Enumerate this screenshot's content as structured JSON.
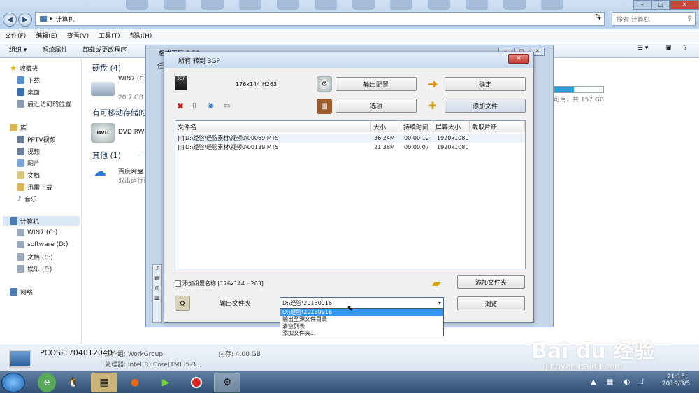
{
  "explorer": {
    "address": "计算机",
    "search_placeholder": "搜索 计算机",
    "menu": [
      "文件(F)",
      "编辑(E)",
      "查看(V)",
      "工具(T)",
      "帮助(H)"
    ],
    "toolbar": [
      "组织 ▾",
      "系统属性",
      "卸载或更改程序"
    ],
    "sidebar": {
      "favorites": "收藏夹",
      "fav_items": [
        "下载",
        "桌面",
        "最近访问的位置"
      ],
      "libraries": "库",
      "lib_items": [
        "PPTV视频",
        "视频",
        "图片",
        "文档",
        "迅雷下载",
        "音乐"
      ],
      "computer": "计算机",
      "drives": [
        "WIN7 (C:)",
        "software (D:)",
        "文档 (E:)",
        "娱乐 (F:)"
      ],
      "network": "网络"
    },
    "content": {
      "group_hdd": "硬盘 (4)",
      "drive_c": "WIN7 (C:",
      "drive_c_free": "20.7 GB",
      "drive_right_free": "可用，共 157 GB",
      "group_removable": "有可移动存储的",
      "dvd": "DVD RW",
      "group_other": "其他 (1)",
      "baidu": "百度网盘",
      "baidu_sub": "双击运行百"
    },
    "status": {
      "pc_name": "PCOS-1704012040",
      "workgroup": "工作组: WorkGroup",
      "memory": "内存: 4.00 GB",
      "cpu": "处理器: Intel(R) Core(TM) i5-3..."
    }
  },
  "format_factory": {
    "title": "格式工厂 2.50",
    "partial_label": "任"
  },
  "dialog": {
    "title": "所有 转到 3GP",
    "preset": "176x144 H263",
    "btn_output_config": "输出配置",
    "btn_ok": "确定",
    "btn_options": "选项",
    "btn_add_file": "添加文件",
    "columns": [
      "文件名",
      "大小",
      "持续时间",
      "屏幕大小",
      "截取片断"
    ],
    "rows": [
      {
        "name": "D:\\经验\\经验素材\\视频0\\00069.MTS",
        "size": "36.24M",
        "duration": "00:00:12",
        "screen": "1920x1080"
      },
      {
        "name": "D:\\经验\\经验素材\\视频0\\00139.MTS",
        "size": "21.38M",
        "duration": "00:00:07",
        "screen": "1920x1080"
      }
    ],
    "add_setting_name": "添加设置名称 [176x144 H263]",
    "btn_add_folder": "添加文件夹",
    "output_folder_label": "输出文件夹",
    "output_folder_value": "D:\\经验\\20180916",
    "btn_browse": "浏览",
    "dropdown_options": [
      "D:\\经验\\20180916",
      "输出至源文件目录",
      "清空列表",
      "添加文件夹..."
    ]
  },
  "taskbar": {
    "time": "21:15",
    "date": "2019/3/5"
  },
  "watermark": {
    "brand": "Bai du 经验",
    "url": "jingyan.baidu.com"
  }
}
